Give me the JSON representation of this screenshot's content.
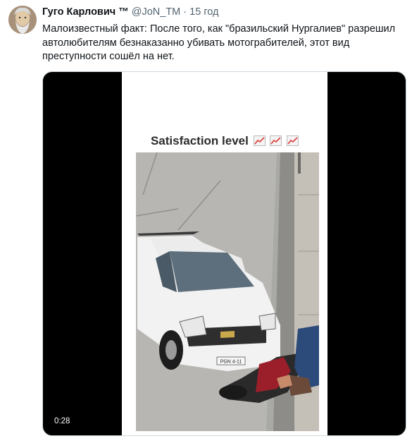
{
  "tweet": {
    "author_name": "Гуго Карлович ™",
    "handle": "@JoN_TM",
    "separator": "·",
    "time": "15 год",
    "text": "Малоизвестный факт: После того, как \"бразильский Нургалиев\" разрешил автолюбителям безнаказанно убивать мотограбителей, этот вид преступности сошёл на нет."
  },
  "media": {
    "caption": "Satisfaction level",
    "caption_icons": [
      "chart-increasing-icon",
      "chart-increasing-icon",
      "chart-increasing-icon"
    ],
    "video_time": "0:28",
    "plate_text": "PGN 4-11"
  }
}
